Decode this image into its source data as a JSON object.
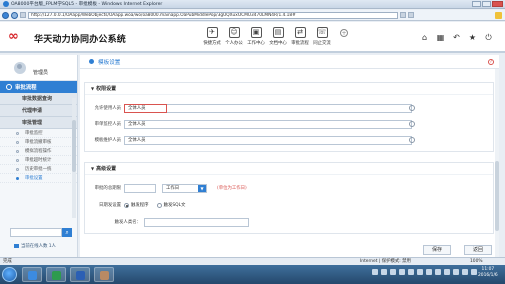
{
  "browser": {
    "title": "OA8000平台版_FPLM学SQL5 - 审批模板 - Windows Internet Explorer",
    "url": "http://127.0.0.1/OAapp/WebObjects/OAapp.woa/wo/oa8000.mainapp.OaPubMiddlePop/3gUQXuxOCMU3470LMN4R/1.4.18#"
  },
  "header": {
    "logo": "∞",
    "brand": "华天动力协同办公系统",
    "tools": [
      {
        "icon": "✈",
        "label": "快捷方式"
      },
      {
        "icon": "☺",
        "label": "个人办公"
      },
      {
        "icon": "▣",
        "label": "工作中心"
      },
      {
        "icon": "▤",
        "label": "文档中心"
      },
      {
        "icon": "⇄",
        "label": "审批流程"
      },
      {
        "icon": "☏",
        "label": "同止交流"
      },
      {
        "icon": "+",
        "label": ""
      }
    ],
    "right_icons": [
      "⌂",
      "▦",
      "↶",
      "★",
      "⏻"
    ]
  },
  "sidebar": {
    "user_name": "管理员",
    "section": "审批流程",
    "groups": [
      "审批数据查询",
      "代理申请",
      "审批管理"
    ],
    "items": [
      "审批监控",
      "审批流撤审核",
      "模拟流程操作",
      "审批超时统计",
      "历史审批一统",
      "审批设置"
    ],
    "active_index": 5,
    "online_text": "当前在线人数 1人"
  },
  "main": {
    "title": "模板设置",
    "help": "?",
    "section1": {
      "title": "权限设置",
      "rows": [
        {
          "label": "允许使用人员",
          "value": "全体人员"
        },
        {
          "label": "审单监控人员",
          "value": "全体人员"
        },
        {
          "label": "模板维护人员",
          "value": "全体人员"
        }
      ]
    },
    "section2": {
      "title": "高级设置",
      "deadline_label": "审批的总期限",
      "deadline_value": "",
      "unit": "工作日",
      "note": "(单位为工作日)",
      "deadline_method_label": "日期发设置",
      "radio_options": [
        "触发程序",
        "触发SQL文"
      ],
      "radio_selected": 0,
      "program_label": "触发人类名："
    },
    "save_button": "保存",
    "back_button": "返回"
  },
  "statusbar": {
    "left": "完成",
    "right": "Internet | 保护模式: 禁用",
    "zoom": "100%"
  },
  "taskbar": {
    "time": "11:07",
    "date": "2016/1/6"
  },
  "colors": {
    "accent": "#2f7fd3",
    "logo": "#d6262b",
    "warning": "#d9534f"
  }
}
